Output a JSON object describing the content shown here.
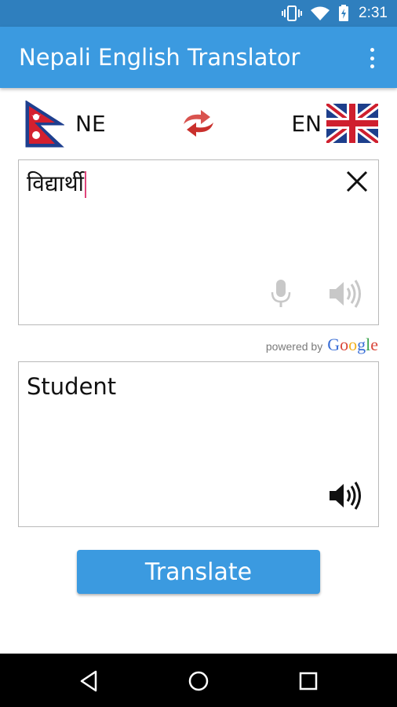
{
  "status_bar": {
    "time": "2:31",
    "icons": [
      "vibrate-icon",
      "wifi-icon",
      "battery-charging-icon"
    ]
  },
  "app_bar": {
    "title": "Nepali English Translator",
    "overflow_icon": "more-vert-icon"
  },
  "languages": {
    "source_code": "NE",
    "target_code": "EN",
    "source_flag": "nepal-flag",
    "target_flag": "uk-flag",
    "swap_icon": "swap-arrows-icon",
    "swap_color": "#d9534f"
  },
  "input": {
    "text": "विद्यार्थी",
    "caret_color": "#e0457b",
    "clear_icon": "close-icon",
    "mic_icon": "microphone-icon",
    "speaker_icon": "speaker-icon"
  },
  "attribution": {
    "powered_by": "powered by",
    "google": [
      "G",
      "o",
      "o",
      "g",
      "l",
      "e"
    ],
    "google_colors": [
      "#3b6fd6",
      "#d9463a",
      "#f2b01e",
      "#3b6fd6",
      "#3aa34c",
      "#d9463a"
    ]
  },
  "output": {
    "text": "Student",
    "speaker_icon": "speaker-icon"
  },
  "translate_button": {
    "label": "Translate",
    "color": "#3b9ae0"
  },
  "nav_bar": {
    "icons": [
      "back-icon",
      "home-icon",
      "recents-icon"
    ]
  },
  "colors": {
    "status_bar": "#2f7fbe",
    "app_bar": "#3b9ae0"
  }
}
